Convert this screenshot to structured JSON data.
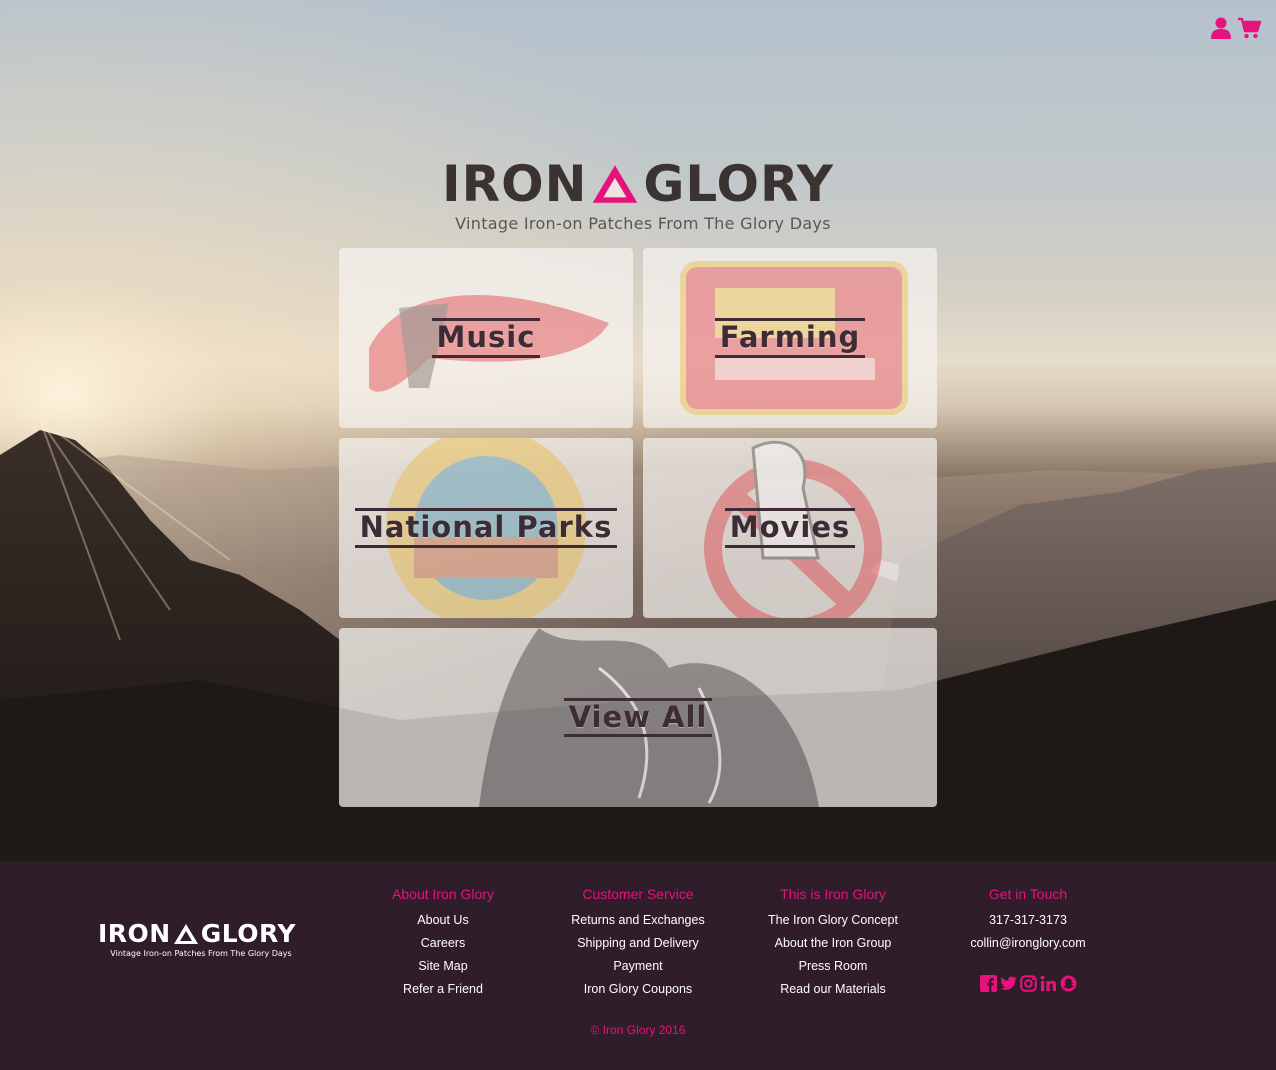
{
  "header": {
    "account_icon": "user-icon",
    "cart_icon": "shopping-cart-icon",
    "accent_color": "#e6137c"
  },
  "logo": {
    "word_left": "IRON",
    "word_right": "GLORY",
    "tagline": "Vintage Iron-on Patches From The Glory Days",
    "mark_color": "#e6137c"
  },
  "categories": [
    {
      "label": "Music"
    },
    {
      "label": "Farming"
    },
    {
      "label": "National Parks"
    },
    {
      "label": "Movies"
    },
    {
      "label": "View All"
    }
  ],
  "footer": {
    "logo": {
      "word_left": "IRON",
      "word_right": "GLORY",
      "tagline": "Vintage Iron-on Patches From The Glory Days"
    },
    "columns": [
      {
        "heading": "About Iron Glory",
        "links": [
          "About Us",
          "Careers",
          "Site Map",
          "Refer a Friend"
        ]
      },
      {
        "heading": "Customer Service",
        "links": [
          "Returns and Exchanges",
          "Shipping and Delivery",
          "Payment",
          "Iron Glory Coupons"
        ]
      },
      {
        "heading": "This is Iron Glory",
        "links": [
          "The Iron Glory Concept",
          "About the Iron Group",
          "Press Room",
          "Read our Materials"
        ]
      },
      {
        "heading": "Get in Touch",
        "links": [
          "317-317-3173",
          "collin@ironglory.com"
        ]
      }
    ],
    "social_icons": [
      "facebook-icon",
      "twitter-icon",
      "instagram-icon",
      "linkedin-icon",
      "snapchat-icon"
    ],
    "copyright": "© Iron Glory 2016",
    "heading_color": "#e6137c",
    "background_color": "#2f1d29"
  }
}
